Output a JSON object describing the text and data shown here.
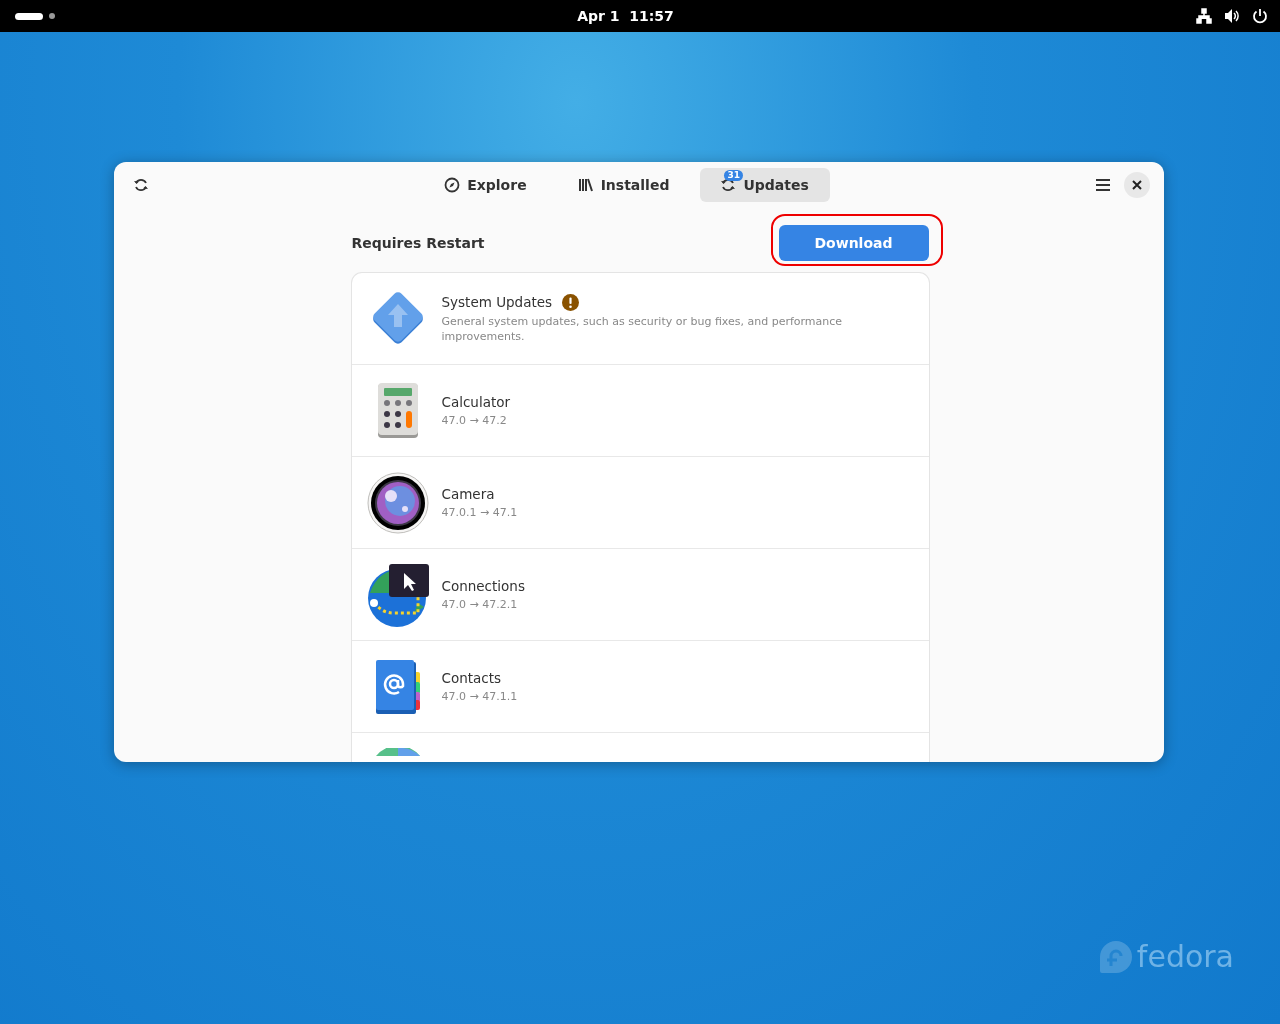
{
  "top_bar": {
    "clock": "Apr 1  11:57"
  },
  "window": {
    "tabs": [
      {
        "label": "Explore",
        "selected": false
      },
      {
        "label": "Installed",
        "selected": false
      },
      {
        "label": "Updates",
        "selected": true,
        "badge": "31"
      }
    ],
    "section_title": "Requires Restart",
    "download_button": "Download",
    "annotation": true,
    "updates": [
      {
        "name": "System Updates",
        "warning": true,
        "description": "General system updates, such as security or bug fixes, and performance improvements."
      },
      {
        "name": "Calculator",
        "warning": false,
        "version": "47.0 → 47.2"
      },
      {
        "name": "Camera",
        "warning": false,
        "version": "47.0.1 → 47.1"
      },
      {
        "name": "Connections",
        "warning": false,
        "version": "47.0 → 47.2.1"
      },
      {
        "name": "Contacts",
        "warning": false,
        "version": "47.0 → 47.1.1"
      }
    ]
  },
  "wallpaper": {
    "logo_text": "fedora"
  }
}
